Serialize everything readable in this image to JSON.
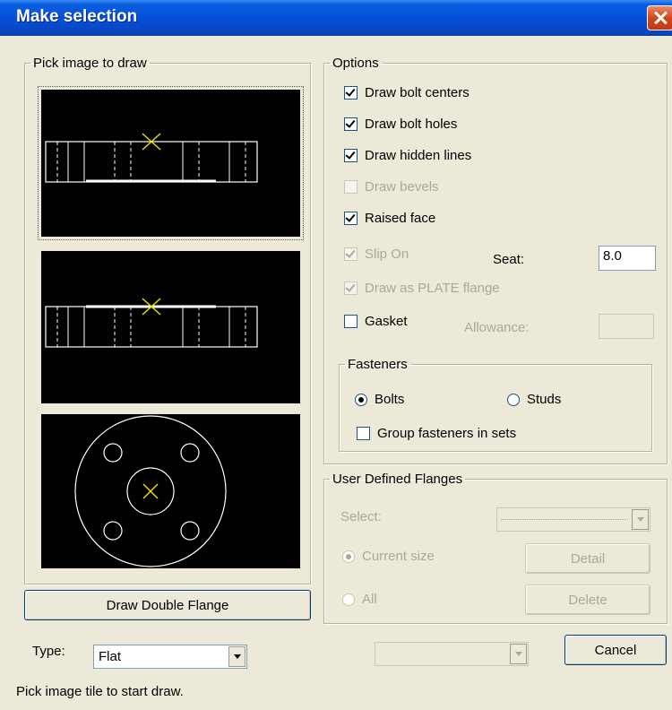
{
  "window": {
    "title": "Make selection"
  },
  "pick_group": {
    "legend": "Pick image to draw"
  },
  "draw_double_flange": {
    "label": "Draw Double Flange"
  },
  "type_field": {
    "label": "Type:",
    "value": "Flat"
  },
  "status_text": "Pick image tile to start draw.",
  "options": {
    "legend": "Options",
    "draw_bolt_centers": {
      "label": "Draw bolt centers",
      "checked": true,
      "enabled": true
    },
    "draw_bolt_holes": {
      "label": "Draw bolt holes",
      "checked": true,
      "enabled": true
    },
    "draw_hidden_lines": {
      "label": "Draw hidden lines",
      "checked": true,
      "enabled": true
    },
    "draw_bevels": {
      "label": "Draw bevels",
      "checked": false,
      "enabled": false
    },
    "raised_face": {
      "label": "Raised face",
      "checked": true,
      "enabled": true
    },
    "slip_on": {
      "label": "Slip On",
      "checked": true,
      "enabled": false
    },
    "seat": {
      "label": "Seat:",
      "value": "8.0"
    },
    "draw_as_plate": {
      "label": "Draw as PLATE flange",
      "checked": true,
      "enabled": false
    },
    "gasket": {
      "label": "Gasket",
      "checked": false,
      "enabled": true
    },
    "allowance": {
      "label": "Allowance:",
      "value": ""
    }
  },
  "fasteners": {
    "legend": "Fasteners",
    "bolts": {
      "label": "Bolts",
      "selected": true
    },
    "studs": {
      "label": "Studs",
      "selected": false
    },
    "group_in_sets": {
      "label": "Group fasteners in sets",
      "checked": false
    }
  },
  "user_defined": {
    "legend": "User Defined Flanges",
    "select_label": "Select:",
    "select_value": "",
    "current_size": {
      "label": "Current size",
      "selected": true
    },
    "all": {
      "label": "All",
      "selected": false
    },
    "detail_button": "Detail",
    "delete_button": "Delete"
  },
  "bottom_combo": {
    "value": ""
  },
  "cancel_button": "Cancel",
  "colors": {
    "titlebar": "#0650d8",
    "tile_bg": "#000000",
    "drawing_lines": "#ffffff",
    "center_mark": "#e8e000"
  },
  "icons": {
    "close": "close-icon"
  }
}
